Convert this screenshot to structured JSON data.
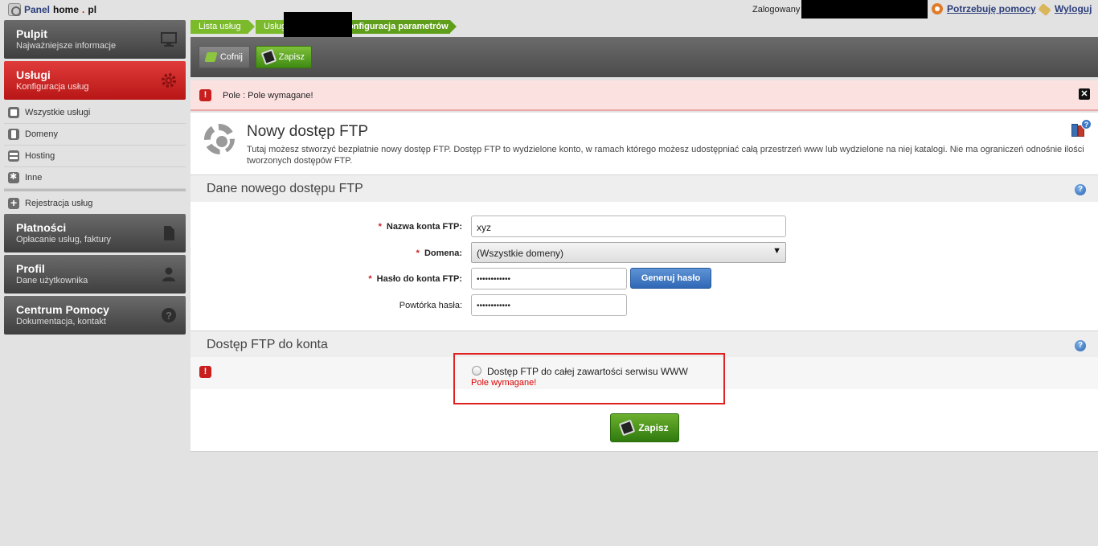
{
  "topbar": {
    "brand_prefix": "Panel ",
    "brand_home": "home",
    "brand_dot": ".",
    "brand_pl": "pl",
    "logged_label": "Zalogowany",
    "help_label": "Potrzebuję pomocy",
    "logout_label": "Wyloguj"
  },
  "sidebar": {
    "nav": [
      {
        "title": "Pulpit",
        "subtitle": "Najważniejsze informacje",
        "icon": "monitor-icon"
      },
      {
        "title": "Usługi",
        "subtitle": "Konfiguracja usług",
        "icon": "gear-icon",
        "active": true
      },
      {
        "title": "Płatności",
        "subtitle": "Opłacanie usług, faktury",
        "icon": "document-icon"
      },
      {
        "title": "Profil",
        "subtitle": "Dane użytkownika",
        "icon": "user-icon"
      },
      {
        "title": "Centrum Pomocy",
        "subtitle": "Dokumentacja, kontakt",
        "icon": "question-icon"
      }
    ],
    "subitems": [
      {
        "label": "Wszystkie usługi",
        "icon": "clipboard-icon"
      },
      {
        "label": "Domeny",
        "icon": "domain-icon"
      },
      {
        "label": "Hosting",
        "icon": "server-icon"
      },
      {
        "label": "Inne",
        "icon": "asterisk-icon"
      },
      {
        "label": "Rejestracja usług",
        "icon": "plus-icon"
      }
    ]
  },
  "breadcrumbs": [
    "Lista usług",
    "Usługa",
    "Konfiguracja parametrów"
  ],
  "toolbar": {
    "back_label": "Cofnij",
    "save_label": "Zapisz"
  },
  "alert": {
    "message": "Pole : Pole wymagane!"
  },
  "header": {
    "title": "Nowy dostęp FTP",
    "description": "Tutaj możesz stworzyć bezpłatnie nowy dostęp FTP. Dostęp FTP to wydzielone konto, w ramach którego możesz udostępniać całą przestrzeń www lub wydzielone na niej katalogi. Nie ma ograniczeń odnośnie ilości tworzonych dostępów FTP."
  },
  "section1": {
    "title": "Dane nowego dostępu FTP",
    "fields": {
      "account_label": "Nazwa konta FTP:",
      "account_value": "xyz",
      "domain_label": "Domena:",
      "domain_value": "(Wszystkie domeny)",
      "password_label": "Hasło do konta FTP:",
      "password_value": "••••••••••••",
      "generate_label": "Generuj hasło",
      "repeat_label": "Powtórka hasła:",
      "repeat_value": "••••••••••••"
    }
  },
  "section2": {
    "title": "Dostęp FTP do konta",
    "radio_label": "Dostęp FTP do całej zawartości serwisu WWW",
    "error": "Pole wymagane!"
  },
  "footer": {
    "save_label": "Zapisz"
  }
}
